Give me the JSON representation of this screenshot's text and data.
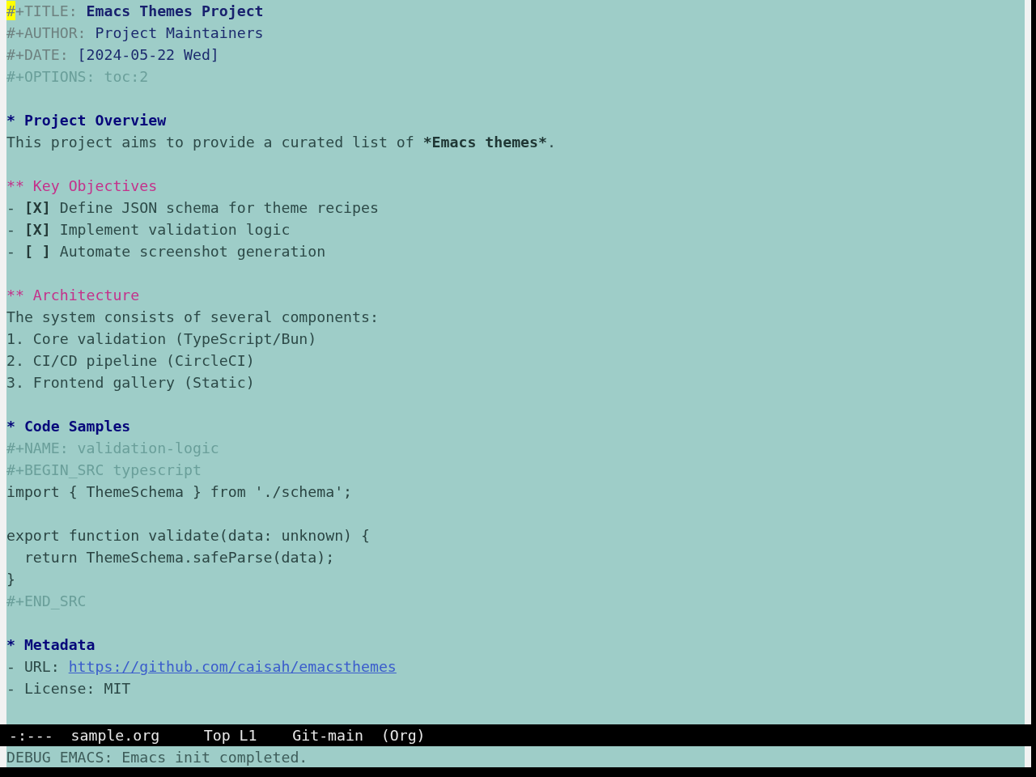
{
  "header": [
    {
      "kind": "title",
      "key": "#+TITLE:",
      "value": "Emacs Themes Project",
      "cursor": true
    },
    {
      "kind": "info",
      "key": "#+AUTHOR:",
      "value": "Project Maintainers",
      "cursor": false
    },
    {
      "kind": "info",
      "key": "#+DATE:",
      "value": "[2024-05-22 Wed]",
      "cursor": false
    },
    {
      "kind": "option",
      "key": "#+OPTIONS:",
      "value": "toc:2",
      "cursor": false
    }
  ],
  "sections": [
    {
      "marker": "*",
      "title": "Project Overview",
      "body": [
        {
          "kind": "paragraph",
          "parts": [
            {
              "text": "This project aims to provide a curated list of ",
              "emphasis": false
            },
            {
              "text": "*Emacs themes*",
              "emphasis": true
            },
            {
              "text": ".",
              "emphasis": false
            }
          ]
        }
      ],
      "children": [
        {
          "marker": "**",
          "title": "Key Objectives",
          "body": [
            {
              "kind": "checklist",
              "items": [
                {
                  "bullet": "-",
                  "checkbox": "[X]",
                  "text": "Define JSON schema for theme recipes"
                },
                {
                  "bullet": "-",
                  "checkbox": "[X]",
                  "text": "Implement validation logic"
                },
                {
                  "bullet": "-",
                  "checkbox": "[ ]",
                  "text": "Automate screenshot generation"
                }
              ]
            }
          ]
        },
        {
          "marker": "**",
          "title": "Architecture",
          "body": [
            {
              "kind": "paragraph",
              "parts": [
                {
                  "text": "The system consists of several components:",
                  "emphasis": false
                }
              ]
            },
            {
              "kind": "ordered",
              "items": [
                {
                  "number": "1.",
                  "text": "Core validation (TypeScript/Bun)"
                },
                {
                  "number": "2.",
                  "text": "CI/CD pipeline (CircleCI)"
                },
                {
                  "number": "3.",
                  "text": "Frontend gallery (Static)"
                }
              ]
            }
          ]
        }
      ]
    },
    {
      "marker": "*",
      "title": "Code Samples",
      "body": [
        {
          "kind": "meta",
          "text": "#+NAME: validation-logic"
        },
        {
          "kind": "meta",
          "text": "#+BEGIN_SRC typescript"
        },
        {
          "kind": "code",
          "text": "import { ThemeSchema } from './schema';\n\nexport function validate(data: unknown) {\n  return ThemeSchema.safeParse(data);\n}"
        },
        {
          "kind": "meta",
          "text": "#+END_SRC"
        }
      ]
    },
    {
      "marker": "*",
      "title": "Metadata",
      "body": [
        {
          "kind": "fields",
          "items": [
            {
              "bullet": "-",
              "label": "URL:",
              "link": "https://github.com/caisah/emacsthemes"
            },
            {
              "bullet": "-",
              "label": "License:",
              "value": "MIT"
            }
          ]
        }
      ]
    }
  ],
  "mode_line": {
    "status": "-:---",
    "buffer_name": "sample.org",
    "position": "Top L1",
    "branch": "Git-main",
    "major_mode": "(Org)"
  },
  "echo_area": {
    "message": "DEBUG EMACS: Emacs init completed."
  }
}
